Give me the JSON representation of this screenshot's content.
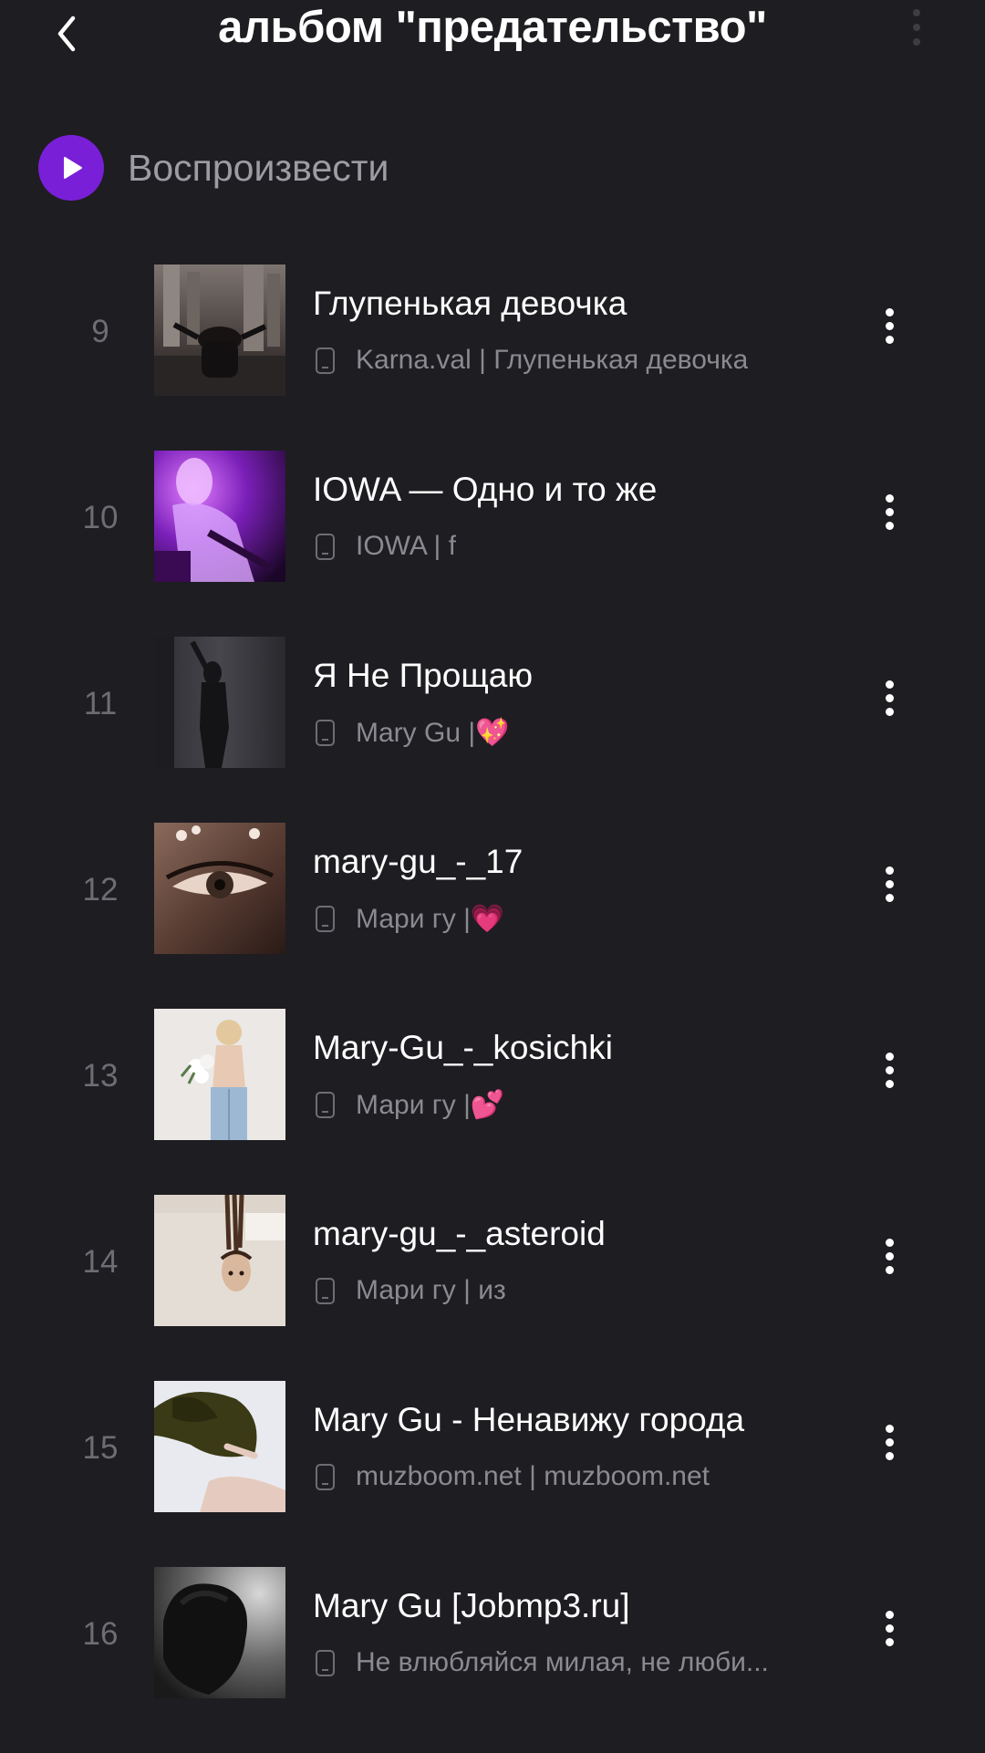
{
  "header": {
    "title": "альбом \"предательство\"",
    "back_icon": "chevron-left-icon",
    "more_icon": "more-vertical-icon"
  },
  "play": {
    "label": "Воспроизвести",
    "icon": "play-icon",
    "accent": "#7a1fd8"
  },
  "tracks": [
    {
      "num": "9",
      "title": "Глупенькая девочка",
      "subtitle": "Karna.val | Глупенькая девочка",
      "emoji": ""
    },
    {
      "num": "10",
      "title": "IOWA — Одно и то же",
      "subtitle": "IOWA  | f",
      "emoji": ""
    },
    {
      "num": "11",
      "title": "Я Не Прощаю",
      "subtitle": "Mary Gu | ",
      "emoji": "💖"
    },
    {
      "num": "12",
      "title": "mary-gu_-_17",
      "subtitle": "Мари гу  | ",
      "emoji": "💗"
    },
    {
      "num": "13",
      "title": "Mary-Gu_-_kosichki",
      "subtitle": "Мари гу  | ",
      "emoji": "💕"
    },
    {
      "num": "14",
      "title": "mary-gu_-_asteroid",
      "subtitle": "Мари гу  | из",
      "emoji": ""
    },
    {
      "num": "15",
      "title": "Mary Gu - Ненавижу города",
      "subtitle": "muzboom.net | muzboom.net",
      "emoji": ""
    },
    {
      "num": "16",
      "title": "Mary Gu  [Jobmp3.ru]",
      "subtitle": "Не влюбляйся милая, не люби...",
      "emoji": ""
    }
  ]
}
